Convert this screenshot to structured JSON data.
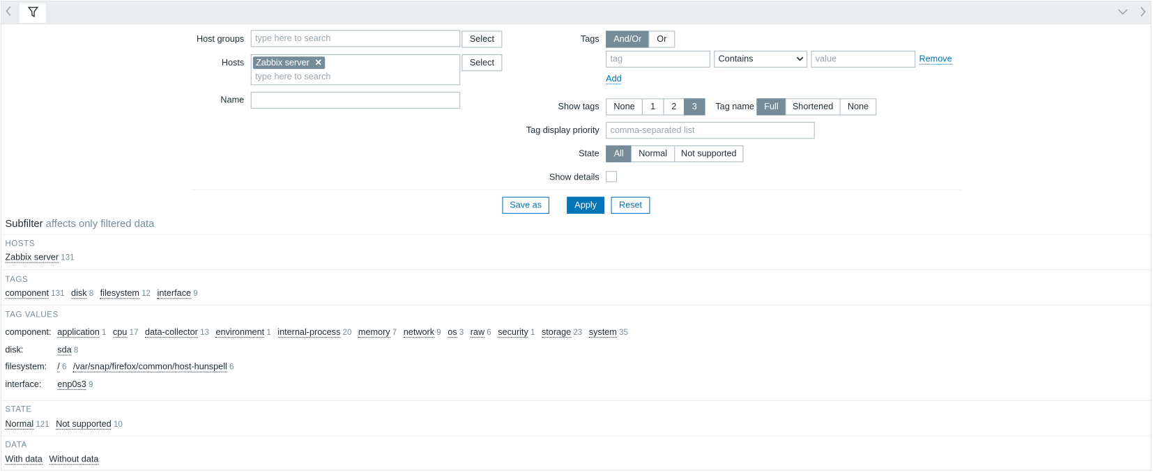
{
  "filter": {
    "host_groups_label": "Host groups",
    "host_groups_placeholder": "type here to search",
    "select_label": "Select",
    "hosts_label": "Hosts",
    "hosts_selected": "Zabbix server",
    "hosts_placeholder": "type here to search",
    "name_label": "Name",
    "name_value": "",
    "tags_label": "Tags",
    "tags_operator": [
      "And/Or",
      "Or"
    ],
    "tag_placeholder": "tag",
    "tag_condition": "Contains",
    "value_placeholder": "value",
    "remove_label": "Remove",
    "add_label": "Add",
    "show_tags_label": "Show tags",
    "show_tags_options": [
      "None",
      "1",
      "2",
      "3"
    ],
    "tag_name_label": "Tag name",
    "tag_name_options": [
      "Full",
      "Shortened",
      "None"
    ],
    "tag_priority_label": "Tag display priority",
    "tag_priority_placeholder": "comma-separated list",
    "state_label": "State",
    "state_options": [
      "All",
      "Normal",
      "Not supported"
    ],
    "show_details_label": "Show details",
    "save_as_label": "Save as",
    "apply_label": "Apply",
    "reset_label": "Reset"
  },
  "subfilter": {
    "title": "Subfilter",
    "subtitle": "affects only filtered data",
    "hosts_header": "HOSTS",
    "hosts": [
      {
        "name": "Zabbix server",
        "count": "131"
      }
    ],
    "tags_header": "TAGS",
    "tags": [
      {
        "name": "component",
        "count": "131"
      },
      {
        "name": "disk",
        "count": "8"
      },
      {
        "name": "filesystem",
        "count": "12"
      },
      {
        "name": "interface",
        "count": "9"
      }
    ],
    "tag_values_header": "TAG VALUES",
    "tag_values": [
      {
        "label": "component:",
        "values": [
          {
            "name": "application",
            "count": "1"
          },
          {
            "name": "cpu",
            "count": "17"
          },
          {
            "name": "data-collector",
            "count": "13"
          },
          {
            "name": "environment",
            "count": "1"
          },
          {
            "name": "internal-process",
            "count": "20"
          },
          {
            "name": "memory",
            "count": "7"
          },
          {
            "name": "network",
            "count": "9"
          },
          {
            "name": "os",
            "count": "3"
          },
          {
            "name": "raw",
            "count": "6"
          },
          {
            "name": "security",
            "count": "1"
          },
          {
            "name": "storage",
            "count": "23"
          },
          {
            "name": "system",
            "count": "35"
          }
        ]
      },
      {
        "label": "disk:",
        "values": [
          {
            "name": "sda",
            "count": "8"
          }
        ]
      },
      {
        "label": "filesystem:",
        "values": [
          {
            "name": "/",
            "count": "6"
          },
          {
            "name": "/var/snap/firefox/common/host-hunspell",
            "count": "6"
          }
        ]
      },
      {
        "label": "interface:",
        "values": [
          {
            "name": "enp0s3",
            "count": "9"
          }
        ]
      }
    ],
    "state_header": "STATE",
    "state": [
      {
        "name": "Normal",
        "count": "121"
      },
      {
        "name": "Not supported",
        "count": "10"
      }
    ],
    "data_header": "DATA",
    "data": [
      {
        "name": "With data",
        "count": ""
      },
      {
        "name": "Without data",
        "count": ""
      }
    ]
  }
}
